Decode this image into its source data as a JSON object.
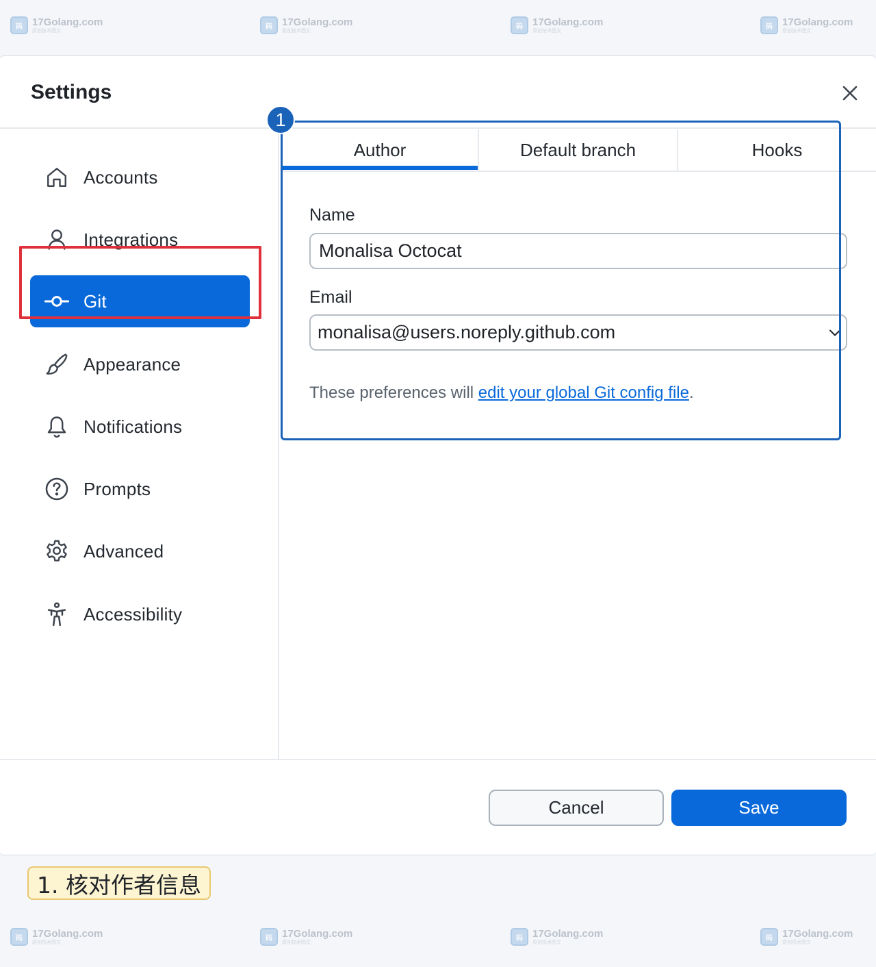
{
  "watermark": {
    "text": "17Golang.com",
    "logo": "码",
    "sub": "原创技术图文"
  },
  "dialog": {
    "title": "Settings",
    "close_icon": "close-icon"
  },
  "sidebar": {
    "items": [
      {
        "label": "Accounts",
        "icon": "home-icon"
      },
      {
        "label": "Integrations",
        "icon": "person-icon"
      },
      {
        "label": "Git",
        "icon": "git-commit-icon",
        "active": true
      },
      {
        "label": "Appearance",
        "icon": "paintbrush-icon"
      },
      {
        "label": "Notifications",
        "icon": "bell-icon"
      },
      {
        "label": "Prompts",
        "icon": "question-icon"
      },
      {
        "label": "Advanced",
        "icon": "gear-icon"
      },
      {
        "label": "Accessibility",
        "icon": "accessibility-icon"
      }
    ]
  },
  "tabs": [
    {
      "label": "Author",
      "active": true
    },
    {
      "label": "Default branch"
    },
    {
      "label": "Hooks"
    }
  ],
  "form": {
    "name_label": "Name",
    "name_value": "Monalisa Octocat",
    "email_label": "Email",
    "email_value": "monalisa@users.noreply.github.com",
    "hint_prefix": "These preferences will ",
    "hint_link": "edit your global Git config file",
    "hint_suffix": "."
  },
  "annotation": {
    "badge": "1",
    "caption": "1. 核对作者信息"
  },
  "footer": {
    "cancel_label": "Cancel",
    "save_label": "Save"
  },
  "colors": {
    "accent": "#0969da",
    "highlight": "#e0303c",
    "annotation": "#1a63b8",
    "caption_bg": "#fdf4d2"
  }
}
